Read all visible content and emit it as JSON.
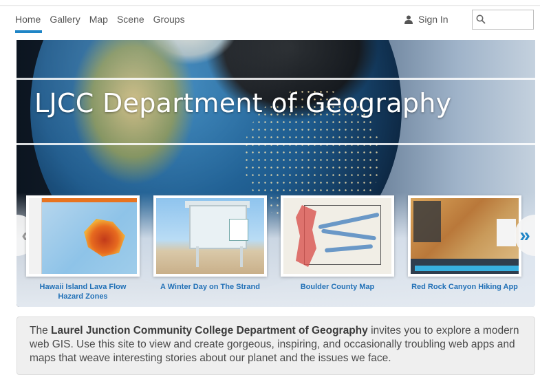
{
  "nav": {
    "items": [
      "Home",
      "Gallery",
      "Map",
      "Scene",
      "Groups"
    ],
    "active": "Home",
    "sign_in": "Sign In",
    "search_placeholder": ""
  },
  "hero": {
    "title": "LJCC Department of Geography"
  },
  "carousel": {
    "prev_symbol": "«",
    "next_symbol": "»",
    "cards": [
      {
        "title": "Hawaii Island Lava Flow Hazard Zones",
        "thumb_icon": "lava-map-thumbnail"
      },
      {
        "title": "A Winter Day on The Strand",
        "thumb_icon": "lifeguard-tower-thumbnail"
      },
      {
        "title": "Boulder County Map",
        "thumb_icon": "county-map-thumbnail"
      },
      {
        "title": "Red Rock Canyon Hiking App",
        "thumb_icon": "hiking-app-thumbnail"
      }
    ]
  },
  "description": {
    "prefix": "The ",
    "bold": "Laurel Junction Community College Department of Geography",
    "suffix": " invites you to explore a modern web GIS. Use this site to view and create gorgeous, inspiring, and occasionally troubling web apps and maps that weave interesting stories about our planet and the issues we face."
  },
  "colors": {
    "accent": "#1f85c6",
    "card_title": "#2271b7"
  }
}
